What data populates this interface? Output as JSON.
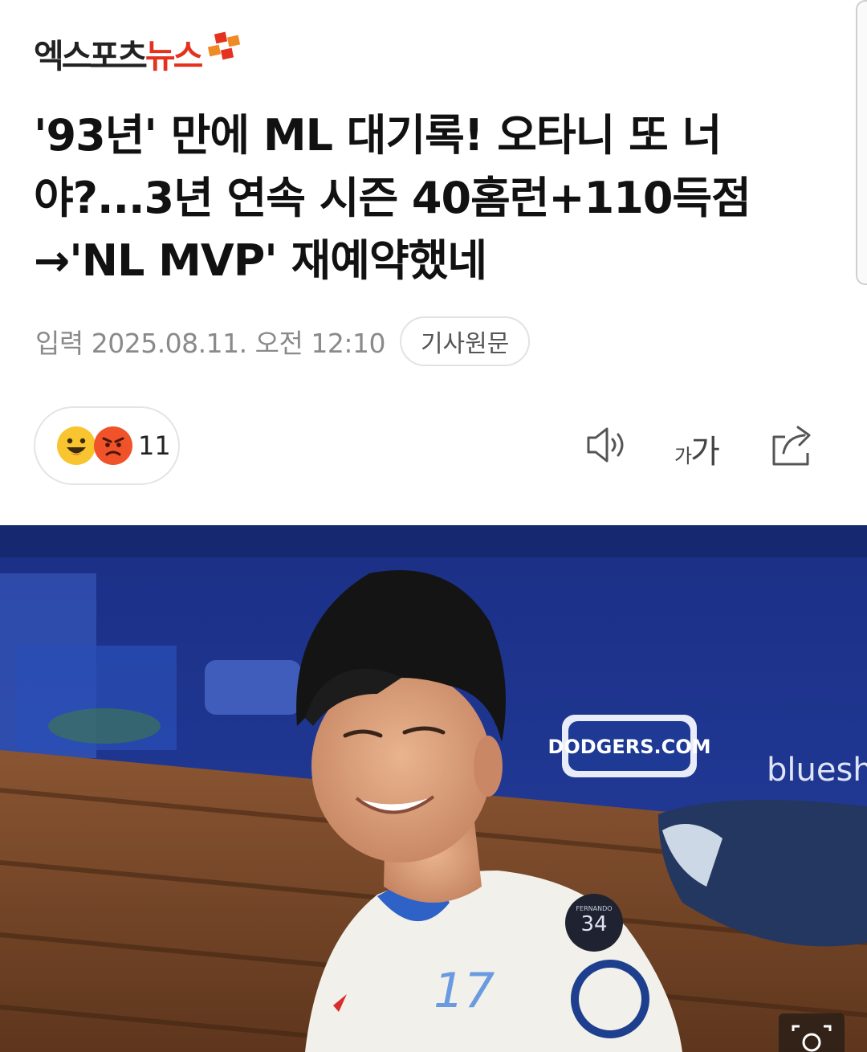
{
  "header": {
    "logo_text_dark": "엑스포츠",
    "logo_text_red": "뉴스",
    "brand_colors": {
      "dark": "#222222",
      "red": "#e4321f",
      "orange": "#f08a24"
    }
  },
  "article": {
    "title": "'93년' 만에 ML 대기록! 오타니 또 너야?...3년 연속 시즌 40홈런+110득점→'NL MVP' 재예약했네",
    "date": "입력 2025.08.11. 오전 12:10",
    "source_button": "기사원문"
  },
  "reactions": {
    "count": "11",
    "icons": [
      "happy-face-icon",
      "angry-face-icon"
    ]
  },
  "toolbar": {
    "font_small": "가",
    "font_large": "가",
    "icons": [
      "speaker-icon",
      "font-size-icon",
      "share-icon"
    ]
  },
  "image": {
    "jersey_number": "17",
    "patch_text": "34",
    "patch_name": "FERNANDO",
    "wall_sign": "DODGERS.COM",
    "wall_text": "blueshie",
    "icons": [
      "zoom-icon"
    ]
  }
}
